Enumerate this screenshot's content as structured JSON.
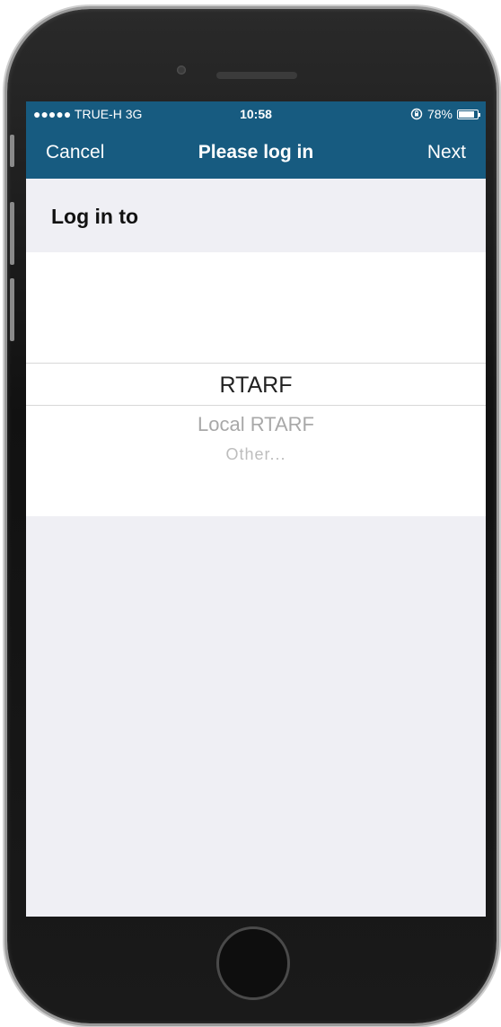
{
  "status_bar": {
    "carrier": "●●●●● TRUE-H  3G",
    "time": "10:58",
    "battery_percent": "78%",
    "battery_level": 0.78,
    "orientation_lock_icon": "rotation-lock-icon"
  },
  "nav": {
    "cancel_label": "Cancel",
    "title": "Please log in",
    "next_label": "Next"
  },
  "section": {
    "header": "Log in to"
  },
  "picker": {
    "options": [
      {
        "label": "RTARF",
        "selected": true
      },
      {
        "label": "Local RTARF",
        "selected": false
      },
      {
        "label": "Other...",
        "selected": false
      }
    ]
  },
  "colors": {
    "nav_background": "#175b80",
    "screen_background": "#efeff4",
    "picker_background": "#ffffff"
  }
}
